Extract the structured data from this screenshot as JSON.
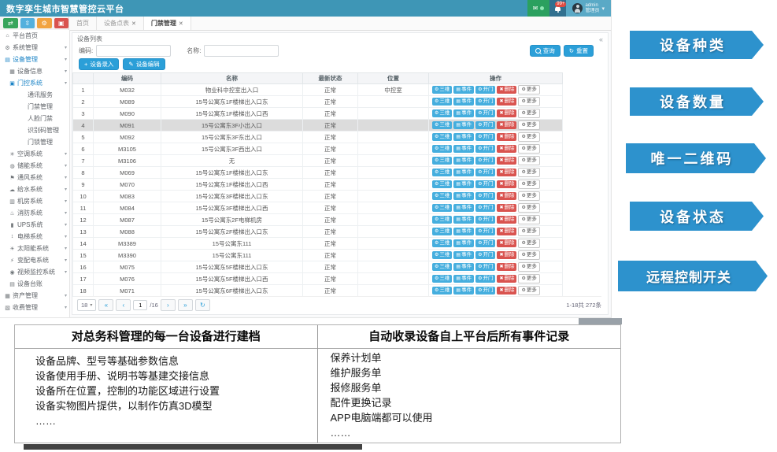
{
  "colors": {
    "header_bar": "#3e96b6",
    "banner_blue": "#2d92cd",
    "primary_button": "#2b9fd8",
    "op_button_blue": "#45aede",
    "delete_red": "#d9534f",
    "active_menu": "#1c84c6"
  },
  "header": {
    "title": "数字孪生城市智慧管控云平台",
    "notification_count": "99+",
    "user_name": "admin",
    "user_role": "管理员"
  },
  "quick_buttons": [
    {
      "name": "layout-toggle-icon",
      "glyph": "⇄",
      "color": "#38a55c"
    },
    {
      "name": "fullscreen-icon",
      "glyph": "⇳",
      "color": "#54b0dd"
    },
    {
      "name": "settings-icon",
      "glyph": "⚙",
      "color": "#f2a340"
    },
    {
      "name": "monitor-icon",
      "glyph": "▣",
      "color": "#d9534f"
    }
  ],
  "tabs": [
    {
      "label": "首页",
      "closable": false,
      "active": false
    },
    {
      "label": "设备点表",
      "closable": true,
      "active": false
    },
    {
      "label": "门禁管理",
      "closable": true,
      "active": true
    }
  ],
  "sidebar": {
    "items": [
      {
        "label": "平台首页",
        "level": 0,
        "icon": "home-icon",
        "glyph": "⌂",
        "chevron": false,
        "active": false
      },
      {
        "label": "系统管理",
        "level": 0,
        "icon": "gear-icon",
        "glyph": "⚙",
        "chevron": true,
        "active": false
      },
      {
        "label": "设备管理",
        "level": 0,
        "icon": "devices-icon",
        "glyph": "▤",
        "chevron": true,
        "active": true
      },
      {
        "label": "设备信息",
        "level": 1,
        "icon": "info-icon",
        "glyph": "▦",
        "chevron": true,
        "active": false
      },
      {
        "label": "门控系统",
        "level": 1,
        "icon": "door-icon",
        "glyph": "▣",
        "chevron": true,
        "active": true
      },
      {
        "label": "通讯服务",
        "level": 2,
        "icon": "",
        "glyph": "",
        "chevron": false,
        "active": false
      },
      {
        "label": "门禁管理",
        "level": 2,
        "icon": "",
        "glyph": "",
        "chevron": false,
        "active": false
      },
      {
        "label": "人脸门禁",
        "level": 2,
        "icon": "",
        "glyph": "",
        "chevron": false,
        "active": false
      },
      {
        "label": "识别码管理",
        "level": 2,
        "icon": "",
        "glyph": "",
        "chevron": false,
        "active": false
      },
      {
        "label": "门锁管理",
        "level": 2,
        "icon": "",
        "glyph": "",
        "chevron": false,
        "active": false
      },
      {
        "label": "空调系统",
        "level": 1,
        "icon": "fan-icon",
        "glyph": "✳",
        "chevron": true,
        "active": false
      },
      {
        "label": "储能系统",
        "level": 1,
        "icon": "energy-icon",
        "glyph": "◍",
        "chevron": true,
        "active": false
      },
      {
        "label": "通风系统",
        "level": 1,
        "icon": "flag-icon",
        "glyph": "⚑",
        "chevron": true,
        "active": false
      },
      {
        "label": "给水系统",
        "level": 1,
        "icon": "water-icon",
        "glyph": "☁",
        "chevron": true,
        "active": false
      },
      {
        "label": "机房系统",
        "level": 1,
        "icon": "server-icon",
        "glyph": "▥",
        "chevron": true,
        "active": false
      },
      {
        "label": "消防系统",
        "level": 1,
        "icon": "fire-icon",
        "glyph": "♨",
        "chevron": true,
        "active": false
      },
      {
        "label": "UPS系统",
        "level": 1,
        "icon": "battery-icon",
        "glyph": "▮",
        "chevron": true,
        "active": false
      },
      {
        "label": "电梯系统",
        "level": 1,
        "icon": "elevator-icon",
        "glyph": "↕",
        "chevron": true,
        "active": false
      },
      {
        "label": "太阳能系统",
        "level": 1,
        "icon": "sun-icon",
        "glyph": "☀",
        "chevron": true,
        "active": false
      },
      {
        "label": "变配电系统",
        "level": 1,
        "icon": "power-icon",
        "glyph": "⚡",
        "chevron": true,
        "active": false
      },
      {
        "label": "视频监控系统",
        "level": 1,
        "icon": "camera-icon",
        "glyph": "◉",
        "chevron": true,
        "active": false
      },
      {
        "label": "设备台账",
        "level": 1,
        "icon": "ledger-icon",
        "glyph": "▤",
        "chevron": false,
        "active": false
      },
      {
        "label": "资产管理",
        "level": 0,
        "icon": "asset-icon",
        "glyph": "▦",
        "chevron": true,
        "active": false
      },
      {
        "label": "收费管理",
        "level": 0,
        "icon": "fee-icon",
        "glyph": "▧",
        "chevron": true,
        "active": false
      }
    ]
  },
  "panel": {
    "title": "设备列表",
    "code_label": "编码:",
    "name_label": "名称:",
    "search_label": "查询",
    "reset_label": "重置",
    "add_label": "设备录入",
    "edit_label": "设备编辑"
  },
  "table": {
    "columns": [
      "编码",
      "名称",
      "最新状态",
      "位置",
      "操作"
    ],
    "op_buttons": [
      {
        "name": "3d-view-button",
        "label": "三维",
        "style": "blue",
        "icon": "gear-icon",
        "glyph": "⚙"
      },
      {
        "name": "event-button",
        "label": "事件",
        "style": "blue",
        "icon": "list-icon",
        "glyph": "▤"
      },
      {
        "name": "open-door-button",
        "label": "开门",
        "style": "blue",
        "icon": "gear-icon",
        "glyph": "⚙"
      },
      {
        "name": "delete-button",
        "label": "删除",
        "style": "red",
        "icon": "delete-icon",
        "glyph": "✖"
      },
      {
        "name": "more-button",
        "label": "更多",
        "style": "more",
        "icon": "gear-icon",
        "glyph": "⚙"
      }
    ],
    "rows": [
      {
        "no": "1",
        "code": "M032",
        "name": "物业科中控室出入口",
        "status": "正常",
        "location": "中控室",
        "selected": false
      },
      {
        "no": "2",
        "code": "M089",
        "name": "15号公寓东1F楼梯出入口东",
        "status": "正常",
        "location": "",
        "selected": false
      },
      {
        "no": "3",
        "code": "M090",
        "name": "15号公寓东1F楼梯出入口西",
        "status": "正常",
        "location": "",
        "selected": false
      },
      {
        "no": "4",
        "code": "M091",
        "name": "15号公寓东3F小出入口",
        "status": "正常",
        "location": "",
        "selected": true
      },
      {
        "no": "5",
        "code": "M092",
        "name": "15号公寓东3F东出入口",
        "status": "正常",
        "location": "",
        "selected": false
      },
      {
        "no": "6",
        "code": "M3105",
        "name": "15号公寓东3F西出入口",
        "status": "正常",
        "location": "",
        "selected": false
      },
      {
        "no": "7",
        "code": "M3106",
        "name": "无",
        "status": "正常",
        "location": "",
        "selected": false
      },
      {
        "no": "8",
        "code": "M069",
        "name": "15号公寓东1F楼梯出入口东",
        "status": "正常",
        "location": "",
        "selected": false
      },
      {
        "no": "9",
        "code": "M070",
        "name": "15号公寓东1F楼梯出入口西",
        "status": "正常",
        "location": "",
        "selected": false
      },
      {
        "no": "10",
        "code": "M083",
        "name": "15号公寓东3F楼梯出入口东",
        "status": "正常",
        "location": "",
        "selected": false
      },
      {
        "no": "11",
        "code": "M084",
        "name": "15号公寓东3F楼梯出入口西",
        "status": "正常",
        "location": "",
        "selected": false
      },
      {
        "no": "12",
        "code": "M087",
        "name": "15号公寓东2F电梯机房",
        "status": "正常",
        "location": "",
        "selected": false
      },
      {
        "no": "13",
        "code": "M088",
        "name": "15号公寓东2F楼梯出入口东",
        "status": "正常",
        "location": "",
        "selected": false
      },
      {
        "no": "14",
        "code": "M3389",
        "name": "15号公寓东111",
        "status": "正常",
        "location": "",
        "selected": false
      },
      {
        "no": "15",
        "code": "M3390",
        "name": "15号公寓东111",
        "status": "正常",
        "location": "",
        "selected": false
      },
      {
        "no": "16",
        "code": "M075",
        "name": "15号公寓东5F楼梯出入口东",
        "status": "正常",
        "location": "",
        "selected": false
      },
      {
        "no": "17",
        "code": "M076",
        "name": "15号公寓东5F楼梯出入口西",
        "status": "正常",
        "location": "",
        "selected": false
      },
      {
        "no": "18",
        "code": "M071",
        "name": "15号公寓东6F楼梯出入口东",
        "status": "正常",
        "location": "",
        "selected": false
      }
    ]
  },
  "pagination": {
    "page_size": "18",
    "page_value": "1",
    "page_total": "/16",
    "first_glyph": "«",
    "prev_glyph": "‹",
    "next_glyph": "›",
    "last_glyph": "»",
    "refresh_glyph": "↻",
    "summary": "1-18共 272条"
  },
  "banners": {
    "color": "#2d92cd",
    "items": [
      "设备种类",
      "设备数量",
      "唯一二维码",
      "设备状态",
      "远程控制开关"
    ]
  },
  "bottom": {
    "left": {
      "title": "对总务科管理的每一台设备进行建档",
      "lines": [
        "设备品牌、型号等基础参数信息",
        "设备使用手册、说明书等基建交接信息",
        "设备所在位置，控制的功能区域进行设置",
        "设备实物图片提供，以制作仿真3D模型",
        "……"
      ]
    },
    "right": {
      "title": "自动收录设备自上平台后所有事件记录",
      "lines": [
        "保养计划单",
        "维护服务单",
        "报修服务单",
        "配件更换记录",
        "APP电脑端都可以使用",
        "……"
      ]
    }
  }
}
